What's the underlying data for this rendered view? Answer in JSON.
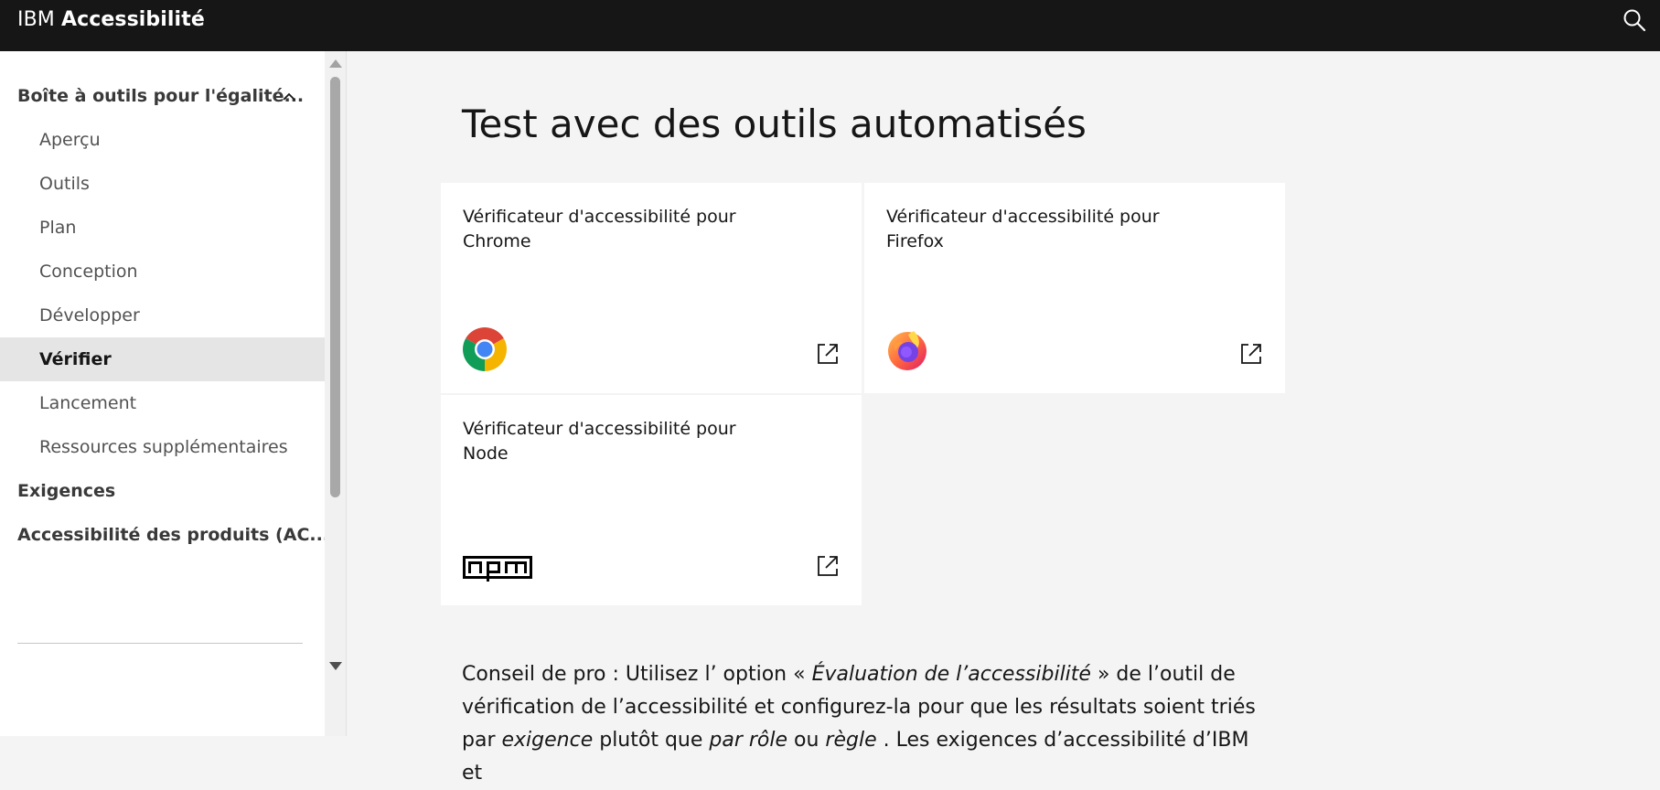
{
  "header": {
    "brand_prefix": "IBM",
    "brand_name": "Accessibilité",
    "search_icon": "search-icon"
  },
  "sidebar": {
    "group_label": "Boîte à outils pour l'égalité...",
    "group_expanded_icon": "chevron-up-icon",
    "items": [
      {
        "label": "Aperçu"
      },
      {
        "label": "Outils"
      },
      {
        "label": "Plan"
      },
      {
        "label": "Conception"
      },
      {
        "label": "Développer"
      },
      {
        "label": "Vérifier",
        "active": true
      },
      {
        "label": "Lancement"
      },
      {
        "label": "Ressources supplémentaires"
      }
    ],
    "other_sections": [
      {
        "label": "Exigences"
      },
      {
        "label": "Accessibilité des produits (AC..."
      }
    ]
  },
  "main": {
    "title": "Test avec des outils automatisés",
    "cards": [
      {
        "title_line1": "Vérificateur d'accessibilité pour",
        "title_line2": "Chrome",
        "logo": "chrome-logo",
        "link_icon": "launch-icon"
      },
      {
        "title_line1": "Vérificateur d'accessibilité pour",
        "title_line2": "Firefox",
        "logo": "firefox-logo",
        "link_icon": "launch-icon"
      },
      {
        "title_line1": "Vérificateur d'accessibilité pour",
        "title_line2": "Node",
        "logo": "npm-logo",
        "link_icon": "launch-icon"
      }
    ],
    "protip": {
      "t1": "Conseil de pro : Utilisez l’ option « ",
      "em1": "Évaluation de l’accessibilité",
      "t2": " » de l’outil de vérification de l’accessibilité et configurez-la pour que les résultats soient triés par ",
      "em2": "exigence",
      "t3": " plutôt que ",
      "em3": "par rôle",
      "t4": " ou ",
      "em4": "règle",
      "t5": " . Les exigences d’accessibilité d’IBM et"
    }
  },
  "colors": {
    "header_bg": "#161616",
    "sidebar_bg": "#ffffff",
    "page_bg": "#f4f4f4",
    "active_item_bg": "#e5e5e5",
    "text_primary": "#161616",
    "text_secondary": "#525252"
  }
}
